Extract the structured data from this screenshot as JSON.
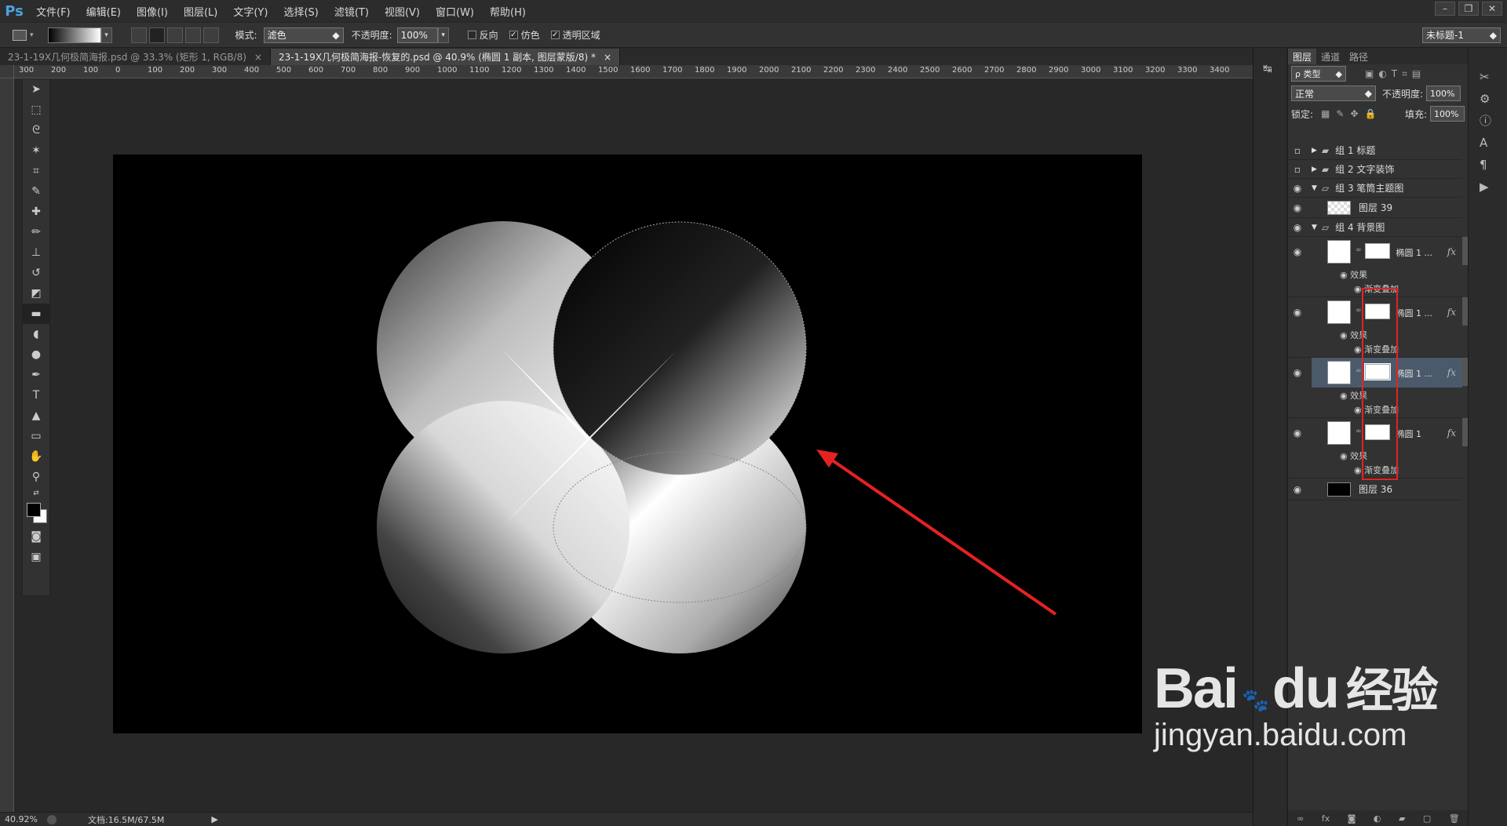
{
  "app": {
    "logo": "Ps"
  },
  "menu": [
    "文件(F)",
    "编辑(E)",
    "图像(I)",
    "图层(L)",
    "文字(Y)",
    "选择(S)",
    "滤镜(T)",
    "视图(V)",
    "窗口(W)",
    "帮助(H)"
  ],
  "window_controls": [
    "–",
    "❐",
    "✕"
  ],
  "options": {
    "mode_label": "模式:",
    "mode_value": "滤色",
    "opacity_label": "不透明度:",
    "opacity_value": "100%",
    "reverse_label": "反向",
    "dither_label": "仿色",
    "transparency_label": "透明区域",
    "workspace_value": "未标题-1"
  },
  "tabs": [
    {
      "label": "23-1-19X几何极简海报.psd @ 33.3% (矩形 1, RGB/8)",
      "close": "×",
      "active": false
    },
    {
      "label": "23-1-19X几何极简海报-恢复的.psd @ 40.9% (椭圆 1 副本, 图层蒙版/8) *",
      "close": "×",
      "active": true
    }
  ],
  "ruler": {
    "h_labels": [
      "300",
      "200",
      "100",
      "0",
      "100",
      "200",
      "300",
      "400",
      "500",
      "600",
      "700",
      "800",
      "900",
      "1000",
      "1100",
      "1200",
      "1300",
      "1400",
      "1500",
      "1600",
      "1700",
      "1800",
      "1900",
      "2000",
      "2100",
      "2200",
      "2300",
      "2400",
      "2500",
      "2600",
      "2700",
      "2800",
      "2900",
      "3000",
      "3100",
      "3200",
      "3300",
      "3400"
    ]
  },
  "status": {
    "zoom": "40.92%",
    "doc": "文档:16.5M/67.5M",
    "arrow": "▶"
  },
  "layers_panel": {
    "tabs": [
      "图层",
      "通道",
      "路径"
    ],
    "filter_label": "ρ 类型",
    "blend_mode": "正常",
    "opacity_label": "不透明度:",
    "opacity_value": "100%",
    "lock_label": "锁定:",
    "fill_label": "填充:",
    "fill_value": "100%",
    "layers": [
      {
        "name": "组 1 标题",
        "type": "group",
        "expanded": false,
        "visible": false
      },
      {
        "name": "组 2 文字装饰",
        "type": "group",
        "expanded": false,
        "visible": false
      },
      {
        "name": "组 3 笔筒主题图",
        "type": "group",
        "expanded": true,
        "visible": true
      },
      {
        "name": "图层 39",
        "type": "layer",
        "visible": true
      },
      {
        "name": "组 4 背景图",
        "type": "group",
        "expanded": true,
        "visible": true
      },
      {
        "name": "椭圆 1 ...",
        "type": "shape",
        "visible": true,
        "effects_label": "效果",
        "effect": "渐变叠加",
        "fx": "fx"
      },
      {
        "name": "椭圆 1 ...",
        "type": "shape",
        "visible": true,
        "effects_label": "效果",
        "effect": "渐变叠加",
        "fx": "fx"
      },
      {
        "name": "椭圆 1 ...",
        "type": "shape",
        "visible": true,
        "selected": true,
        "effects_label": "效果",
        "effect": "渐变叠加",
        "fx": "fx"
      },
      {
        "name": "椭圆 1",
        "type": "shape",
        "visible": true,
        "effects_label": "效果",
        "effect": "渐变叠加",
        "fx": "fx"
      },
      {
        "name": "图层 36",
        "type": "layer",
        "visible": true
      }
    ]
  },
  "watermark": {
    "brand": "Bai",
    "brand2": "du",
    "cn": "经验",
    "url": "jingyan.baidu.com"
  },
  "colors": {
    "annotation_red": "#e52222",
    "selection_blue": "#4b5a6b",
    "ps_blue": "#4aa3e0"
  }
}
